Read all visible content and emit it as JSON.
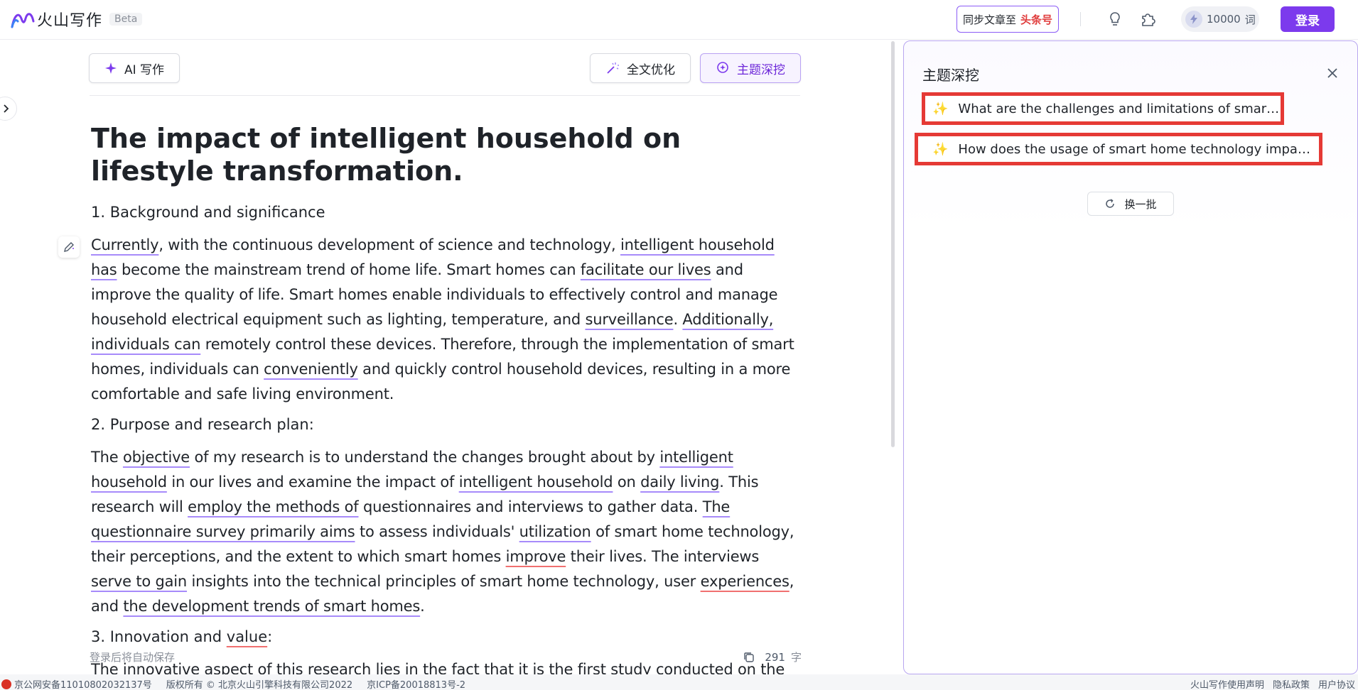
{
  "header": {
    "logo_text": "火山写作",
    "beta_label": "Beta",
    "sync_label": "同步文章至",
    "sync_target": "头条号",
    "credits_value": "10000",
    "credits_unit": "词",
    "login_label": "登录",
    "icons": [
      "lightbulb-icon",
      "plugin-icon",
      "bolt-icon"
    ]
  },
  "toolbar": {
    "ai_write_label": "AI 写作",
    "optimize_label": "全文优化",
    "topic_dig_label": "主题深挖"
  },
  "document": {
    "title": "The impact of intelligent household on lifestyle transformation.",
    "heading1": "1. Background and significance",
    "p1": [
      {
        "t": "Currently",
        "u": "purple"
      },
      {
        "t": ", with the continuous development of science and technology, "
      },
      {
        "t": "intelligent household has",
        "u": "purple"
      },
      {
        "t": " become the mainstream trend of home life. Smart homes can "
      },
      {
        "t": "facilitate our lives",
        "u": "purple"
      },
      {
        "t": " and improve the quality of life. Smart homes enable individuals to effectively control and manage household electrical equipment such as lighting, temperature, and "
      },
      {
        "t": "surveillance",
        "u": "purple"
      },
      {
        "t": ". "
      },
      {
        "t": "Additionally, individuals can",
        "u": "purple"
      },
      {
        "t": " remotely control these devices. Therefore, through the implementation of smart homes, individuals can "
      },
      {
        "t": "conveniently",
        "u": "purple"
      },
      {
        "t": " and quickly control household devices, resulting in a more comfortable and safe living environment."
      }
    ],
    "heading2": "2. Purpose and research plan:",
    "p2": [
      {
        "t": "The "
      },
      {
        "t": "objective",
        "u": "purple"
      },
      {
        "t": " of my research is to understand the changes brought about by "
      },
      {
        "t": "intelligent household",
        "u": "purple"
      },
      {
        "t": " in our lives and examine the impact of "
      },
      {
        "t": "intelligent household",
        "u": "purple"
      },
      {
        "t": " on "
      },
      {
        "t": "daily living",
        "u": "purple"
      },
      {
        "t": ". This research will "
      },
      {
        "t": "employ the methods of",
        "u": "purple"
      },
      {
        "t": " questionnaires and interviews to gather data. "
      },
      {
        "t": "The questionnaire survey primarily aims",
        "u": "purple"
      },
      {
        "t": " to assess individuals' "
      },
      {
        "t": "utilization",
        "u": "purple"
      },
      {
        "t": " of smart home technology, their perceptions, and the extent to which smart homes "
      },
      {
        "t": "improve",
        "u": "red"
      },
      {
        "t": " their lives. The interviews "
      },
      {
        "t": "serve to gain",
        "u": "purple"
      },
      {
        "t": " insights into the technical principles of smart home technology, user "
      },
      {
        "t": "experiences",
        "u": "red"
      },
      {
        "t": ", and "
      },
      {
        "t": "the development trends of smart homes",
        "u": "purple"
      },
      {
        "t": "."
      }
    ],
    "heading3_prefix": "3. Innovation and ",
    "heading3_value": "value",
    "heading3_suffix": ":",
    "p3": [
      {
        "t": "The innovative aspect of this research "
      },
      {
        "t": "lies in the fact",
        "u": "purple"
      },
      {
        "t": " that it is the first study conducted on the"
      }
    ]
  },
  "footer": {
    "autosave_label": "登录后将自动保存",
    "word_count": "291",
    "word_unit": "字"
  },
  "panel": {
    "title": "主题深挖",
    "suggestions": [
      "What are the challenges and limitations of smart homes?",
      "How does the usage of smart home technology impact family dynamics and relationships?"
    ],
    "refresh_label": "换一批"
  },
  "statusbar": {
    "police_record": "京公网安备11010802032137号",
    "copyright": "版权所有 © 北京火山引擎科技有限公司2022",
    "icp": "京ICP备20018813号-2",
    "links": [
      "火山写作使用声明",
      "隐私政策",
      "用户协议"
    ]
  },
  "colors": {
    "accent": "#7c3aed",
    "underline_purple": "#a78bfa",
    "underline_red": "#f07070",
    "highlight_box": "#e53935"
  }
}
